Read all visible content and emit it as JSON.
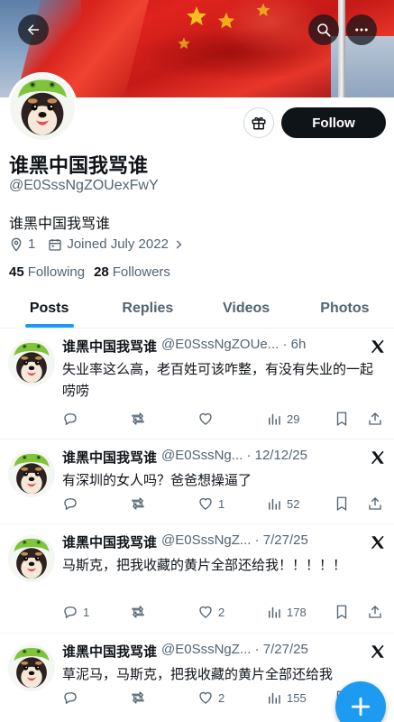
{
  "profile": {
    "display_name": "谁黑中国我骂谁",
    "handle": "@E0SssNgZOUexFwY",
    "bio": "谁黑中国我骂谁",
    "location": "1",
    "joined": "Joined July 2022",
    "following_count": "45",
    "following_label": "Following",
    "followers_count": "28",
    "followers_label": "Followers",
    "follow_label": "Follow"
  },
  "tabs": [
    {
      "label": "Posts",
      "active": true
    },
    {
      "label": "Replies",
      "active": false
    },
    {
      "label": "Videos",
      "active": false
    },
    {
      "label": "Photos",
      "active": false
    }
  ],
  "posts": [
    {
      "name": "谁黑中国我骂谁",
      "handle_time": "@E0SssNgZOUe... · 6h",
      "text": "失业率这么高，老百姓可该咋整，有没有失业的一起唠唠",
      "replies": "",
      "retweets": "",
      "likes": "",
      "views": "29"
    },
    {
      "name": "谁黑中国我骂谁",
      "handle_time": "@E0SssNg... · 12/12/25",
      "text": "有深圳的女人吗？爸爸想操逼了",
      "replies": "",
      "retweets": "",
      "likes": "1",
      "views": "52"
    },
    {
      "name": "谁黑中国我骂谁",
      "handle_time": "@E0SssNgZ... · 7/27/25",
      "text": "马斯克，把我收藏的黄片全部还给我！！！！！",
      "replies": "1",
      "retweets": "",
      "likes": "2",
      "views": "178"
    },
    {
      "name": "谁黑中国我骂谁",
      "handle_time": "@E0SssNgZ... · 7/27/25",
      "text": "草泥马，马斯克，把我收藏的黄片全部还给我",
      "replies": "",
      "retweets": "",
      "likes": "2",
      "views": "155"
    }
  ],
  "icons": {
    "back": "back-arrow-icon",
    "search": "search-icon",
    "more": "more-dots-icon",
    "gift": "gift-icon",
    "location": "location-pin-icon",
    "calendar": "calendar-icon",
    "x_logo": "x-logo-icon",
    "compose": "plus-icon"
  },
  "colors": {
    "accent": "#1d9bf0",
    "text": "#0f1419",
    "muted": "#536471",
    "follow_bg": "#0f1419"
  }
}
